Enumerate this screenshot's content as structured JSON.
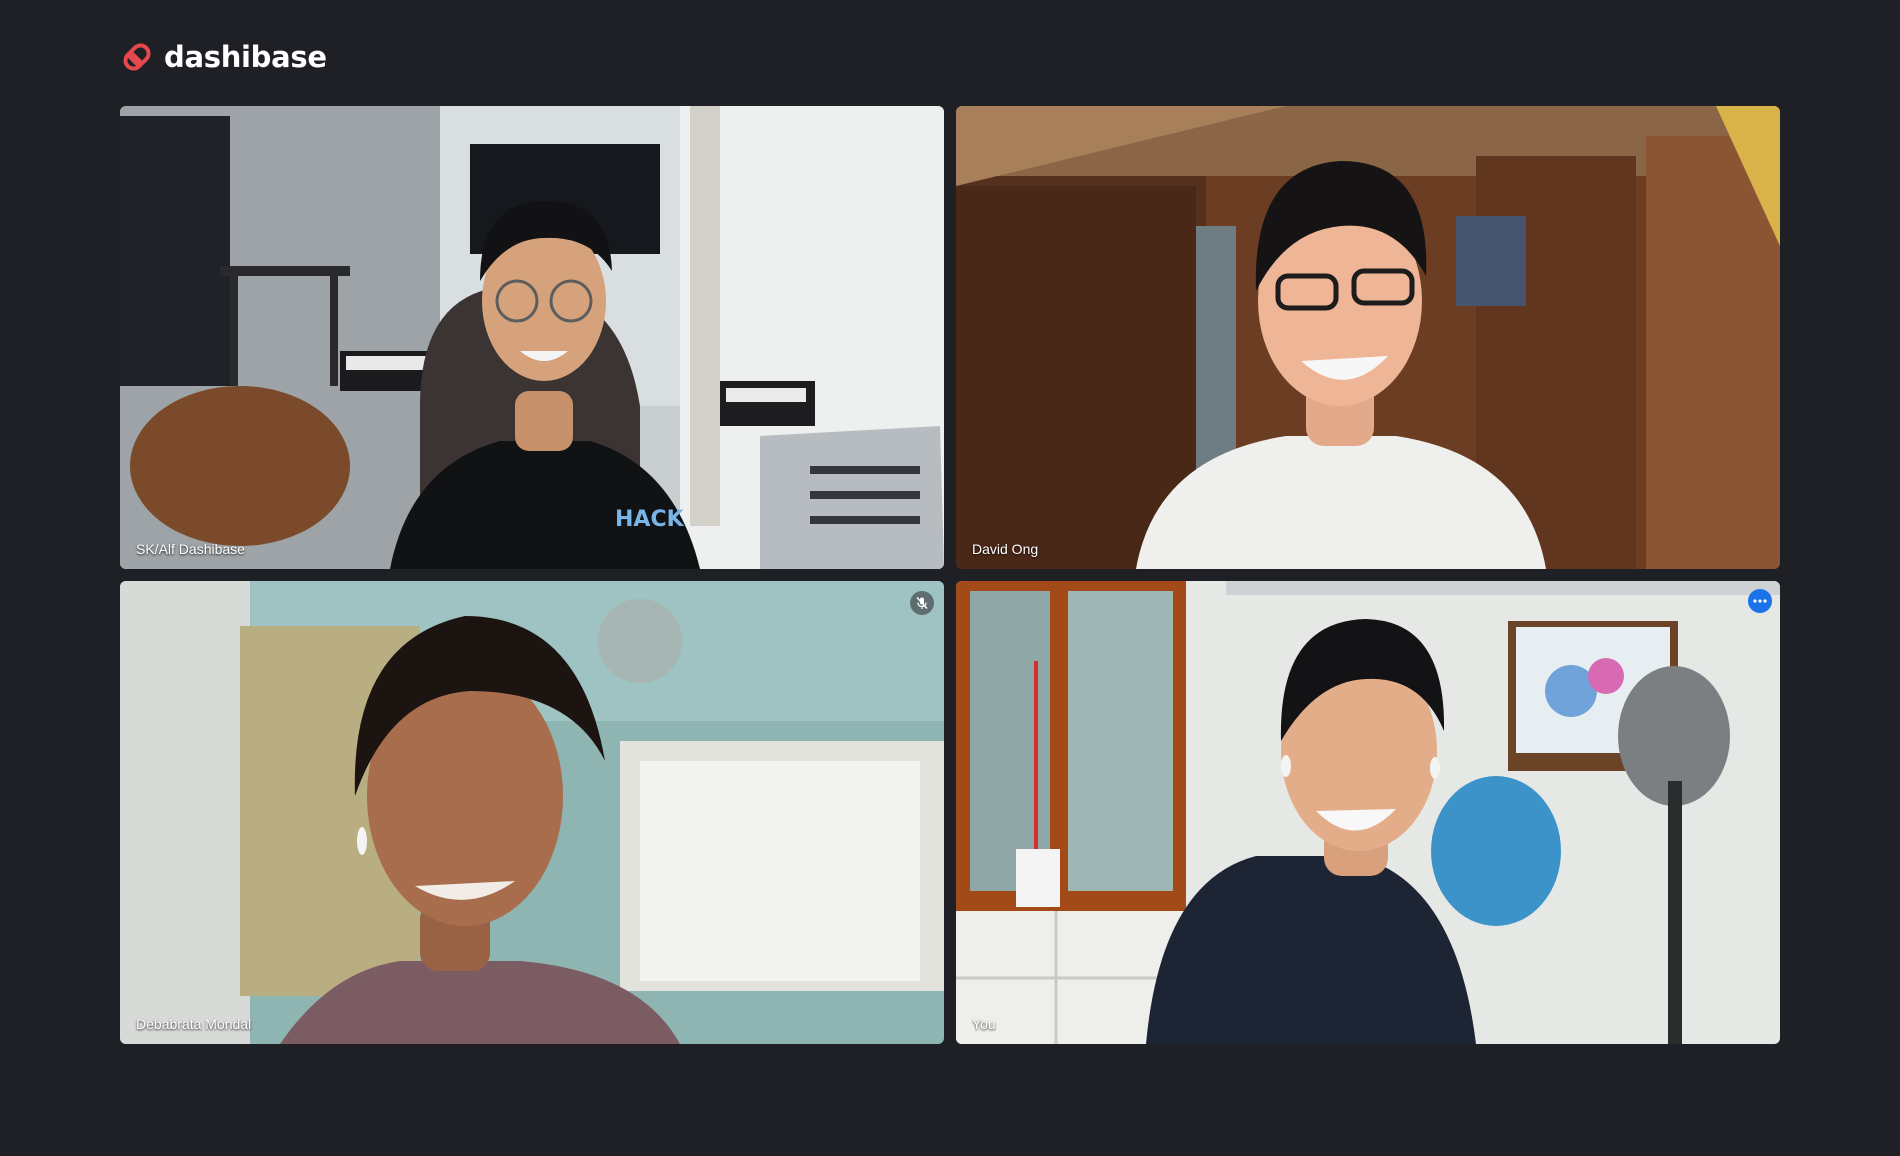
{
  "app": {
    "name": "dashibase"
  },
  "participants": [
    {
      "name": "SK/Alf Dashibase",
      "muted": false,
      "is_self": false
    },
    {
      "name": "David Ong",
      "muted": false,
      "is_self": false
    },
    {
      "name": "Debabrata Mondal",
      "muted": true,
      "is_self": false
    },
    {
      "name": "You",
      "muted": false,
      "is_self": true
    }
  ],
  "colors": {
    "background": "#1f2026",
    "brand": "#e5484d",
    "self_highlight": "#4a86e8",
    "menu_button": "#1a73e8"
  },
  "icons": {
    "logo": "dashibase-logo-icon",
    "mute": "mic-off-icon",
    "menu": "more-horizontal-icon"
  }
}
